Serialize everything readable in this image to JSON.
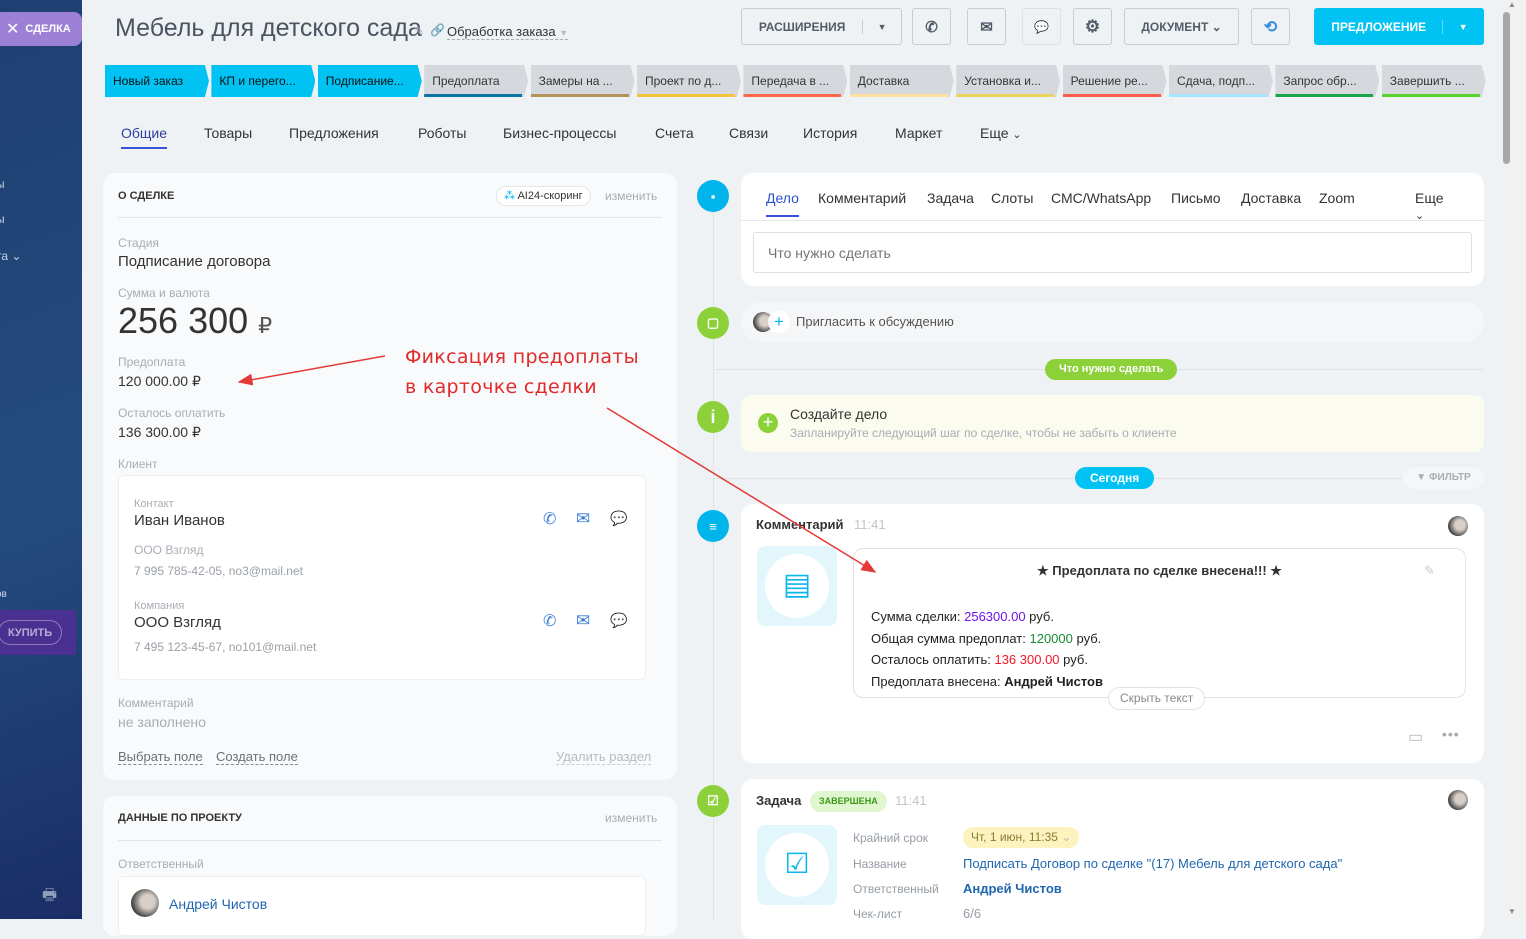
{
  "sidebar": {
    "deal_tab": "СДЕЛКА",
    "fragments": [
      "ы",
      "ы",
      "та",
      "ов"
    ],
    "buy": "КУПИТЬ"
  },
  "header": {
    "title": "Мебель для детского сада",
    "pipeline": "Обработка заказа",
    "extensions": "РАСШИРЕНИЯ",
    "document": "ДОКУМЕНТ",
    "proposal": "ПРЕДЛОЖЕНИЕ"
  },
  "stages": [
    {
      "label": "Новый заказ",
      "color": "#00c3f3",
      "active": true
    },
    {
      "label": "КП и перего...",
      "color": "#00c3f3",
      "active": true
    },
    {
      "label": "Подписание...",
      "color": "#00c3f3",
      "active": true
    },
    {
      "label": "Предоплата",
      "color": "#0a74a6",
      "active": false
    },
    {
      "label": "Замеры на ...",
      "color": "#b39359",
      "active": false
    },
    {
      "label": "Проект по д...",
      "color": "#f5c33b",
      "active": false
    },
    {
      "label": "Передача в ...",
      "color": "#ff6a4d",
      "active": false
    },
    {
      "label": "Доставка",
      "color": "#ffe09e",
      "active": false
    },
    {
      "label": "Установка и...",
      "color": "#e8d35c",
      "active": false
    },
    {
      "label": "Решение ре...",
      "color": "#ff5d4a",
      "active": false
    },
    {
      "label": "Сдача, подп...",
      "color": "#a6e5ff",
      "active": false
    },
    {
      "label": "Запрос обр...",
      "color": "#1aa54c",
      "active": false
    },
    {
      "label": "Завершить ...",
      "color": "#59d42e",
      "active": false
    }
  ],
  "tabs": [
    "Общие",
    "Товары",
    "Предложения",
    "Роботы",
    "Бизнес-процессы",
    "Счета",
    "Связи",
    "История",
    "Маркет",
    "Еще"
  ],
  "about": {
    "title": "О СДЕЛКЕ",
    "ai": "AI24-скоринг",
    "edit": "изменить",
    "stage_label": "Стадия",
    "stage": "Подписание договора",
    "sum_label": "Сумма и валюта",
    "sum": "256 300",
    "currency": "₽",
    "prepay_label": "Предоплата",
    "prepay": "120 000.00 ₽",
    "left_label": "Осталось оплатить",
    "left": "136 300.00 ₽",
    "client_label": "Клиент",
    "contact_label": "Контакт",
    "contact": "Иван Иванов",
    "contact_company": "ООО Взгляд",
    "contact_info": "7 995 785-42-05, no3@mail.net",
    "company_label": "Компания",
    "company": "ООО Взгляд",
    "company_info": "7 495 123-45-67, no101@mail.net",
    "comment_label": "Комментарий",
    "comment": "не заполнено",
    "choose_field": "Выбрать поле",
    "create_field": "Создать поле",
    "delete_section": "Удалить раздел"
  },
  "project": {
    "title": "ДАННЫЕ ПО ПРОЕКТУ",
    "edit": "изменить",
    "resp_label": "Ответственный",
    "resp": "Андрей Чистов"
  },
  "annotation": {
    "line1": "Фиксация предоплаты",
    "line2": "в карточке сделки"
  },
  "timeline": {
    "tabs": [
      "Дело",
      "Комментарий",
      "Задача",
      "Слоты",
      "СМС/WhatsApp",
      "Письмо",
      "Доставка",
      "Zoom",
      "Еще"
    ],
    "placeholder": "Что нужно сделать",
    "invite": "Пригласить к обсуждению",
    "todo_badge": "Что нужно сделать",
    "create_title": "Создайте дело",
    "create_sub": "Запланируйте следующий шаг по сделке, чтобы не забыть о клиенте",
    "today": "Сегодня",
    "filter": "ФИЛЬТР",
    "comment": {
      "type": "Комментарий",
      "time": "11:41",
      "headline": "★ Предоплата по сделке внесена!!! ★",
      "l1a": "Сумма сделки: ",
      "l1b": "256300.00",
      "l1c": " руб.",
      "l2a": "Общая сумма предоплат: ",
      "l2b": "120000",
      "l2c": " руб.",
      "l3a": "Осталось оплатить: ",
      "l3b": "136 300.00",
      "l3c": " руб.",
      "l4a": "Предоплата внесена: ",
      "l4b": "Андрей Чистов",
      "hide": "Скрыть текст"
    },
    "task": {
      "type": "Задача",
      "status": "ЗАВЕРШЕНА",
      "time": "11:41",
      "deadline_label": "Крайний срок",
      "deadline": "Чт, 1 июн, 11:35",
      "name_label": "Название",
      "name": "Подписать Договор по сделке \"(17) Мебель для детского сада\"",
      "resp_label": "Ответственный",
      "resp": "Андрей Чистов",
      "check_label": "Чек-лист",
      "check": "6/6"
    }
  }
}
